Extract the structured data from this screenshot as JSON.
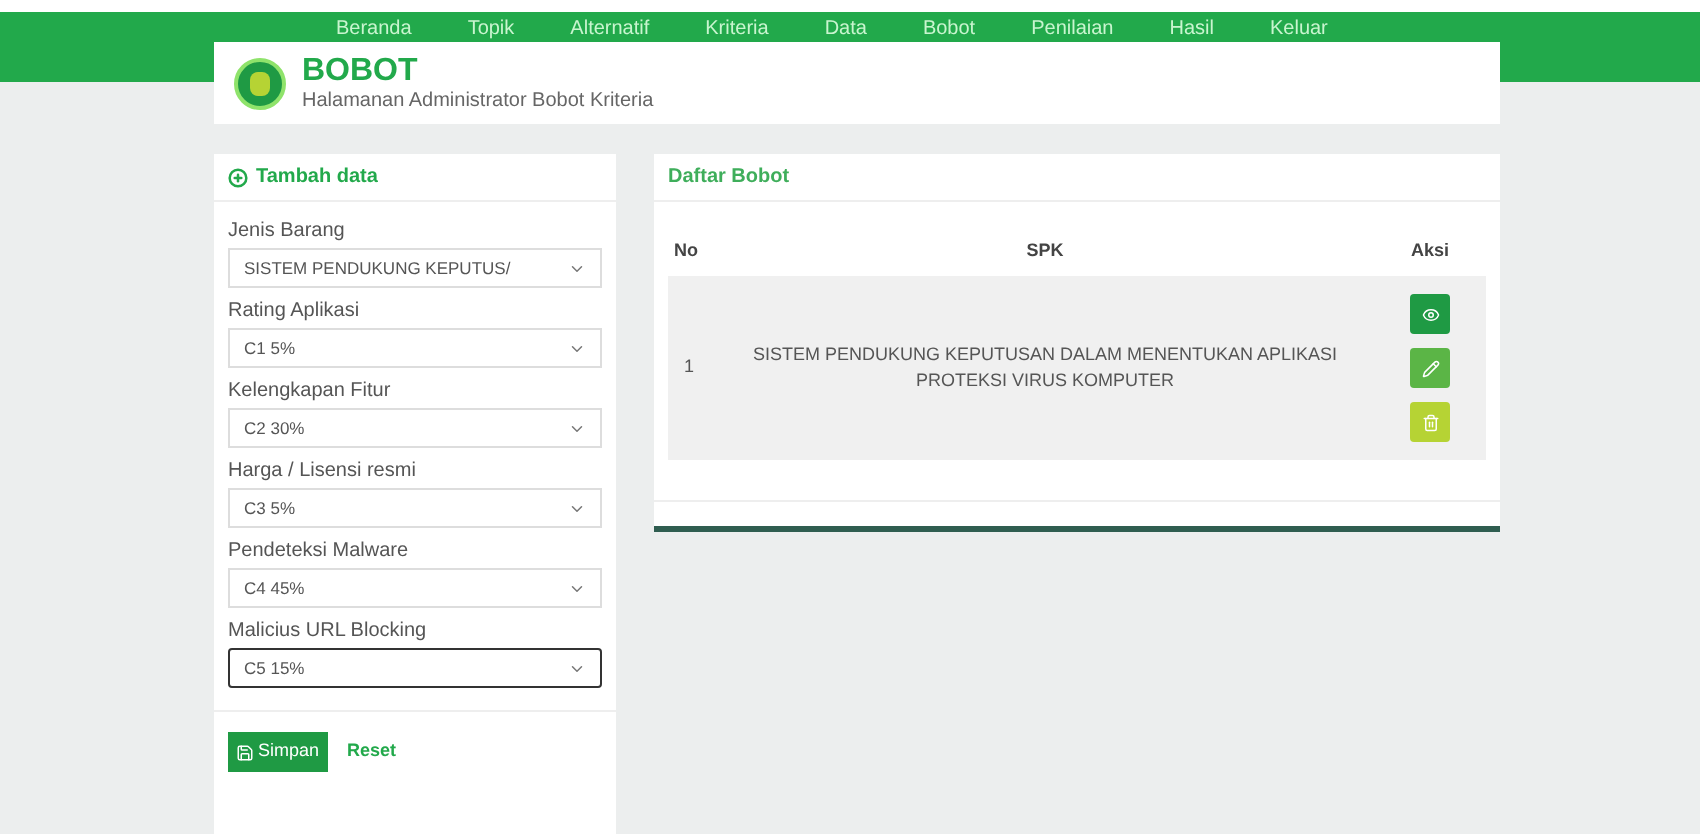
{
  "nav": [
    {
      "label": "Beranda"
    },
    {
      "label": "Topik"
    },
    {
      "label": "Alternatif"
    },
    {
      "label": "Kriteria"
    },
    {
      "label": "Data"
    },
    {
      "label": "Bobot"
    },
    {
      "label": "Penilaian"
    },
    {
      "label": "Hasil"
    },
    {
      "label": "Keluar"
    }
  ],
  "header": {
    "title": "BOBOT",
    "subtitle": "Halamanan Administrator Bobot Kriteria"
  },
  "form": {
    "title": "Tambah data",
    "fields": [
      {
        "label": "Jenis Barang",
        "value": "SISTEM PENDUKUNG KEPUTUS/",
        "focused": false
      },
      {
        "label": "Rating Aplikasi",
        "value": "C1 5%",
        "focused": false
      },
      {
        "label": "Kelengkapan Fitur",
        "value": "C2 30%",
        "focused": false
      },
      {
        "label": "Harga / Lisensi resmi",
        "value": "C3 5%",
        "focused": false
      },
      {
        "label": "Pendeteksi Malware",
        "value": "C4 45%",
        "focused": false
      },
      {
        "label": "Malicius URL Blocking",
        "value": "C5 15%",
        "focused": true
      }
    ],
    "save": "Simpan",
    "reset": "Reset"
  },
  "table": {
    "title": "Daftar Bobot",
    "columns": [
      "No",
      "SPK",
      "Aksi"
    ],
    "rows": [
      {
        "no": "1",
        "spk": "SISTEM PENDUKUNG KEPUTUSAN DALAM MENENTUKAN APLIKASI PROTEKSI VIRUS KOMPUTER",
        "actions": [
          {
            "kind": "view"
          },
          {
            "kind": "edit"
          },
          {
            "kind": "delete"
          }
        ]
      }
    ]
  }
}
